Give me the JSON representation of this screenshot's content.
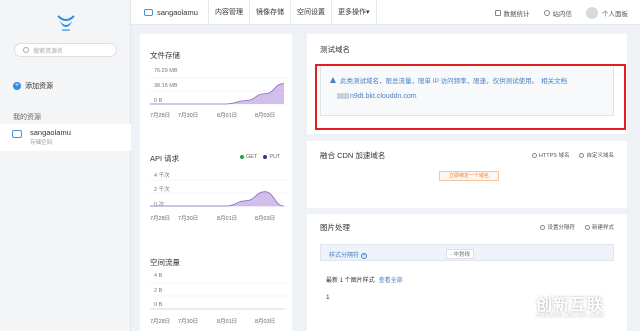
{
  "sidebar": {
    "search_placeholder": "搜索资源名",
    "add_resource_label": "添加资源",
    "my_resources_label": "我的资源",
    "resource": {
      "name": "sangaolamu",
      "type": "存储空间"
    }
  },
  "topbar": {
    "bucket_name": "sangaolamu",
    "tabs": [
      "内容管理",
      "镜像存储",
      "空间设置",
      "更多操作"
    ],
    "more_caret": "▾",
    "stats_label": "数据统计",
    "messages_label": "站内信",
    "user_label": "个人面板"
  },
  "storage_chart": {
    "title": "文件存储",
    "y_ticks": [
      "76.29 MB",
      "38.15 MB",
      "0 B"
    ],
    "x_ticks": [
      "7月28日",
      "7月30日",
      "8月01日",
      "8月03日"
    ]
  },
  "api_chart": {
    "title": "API 请求",
    "legend": [
      {
        "name": "GET",
        "color": "#2e9e44"
      },
      {
        "name": "PUT",
        "color": "#3a2c8a"
      }
    ],
    "y_ticks": [
      "4 千次",
      "2 千次",
      "0 次"
    ],
    "x_ticks": [
      "7月28日",
      "7月30日",
      "8月01日",
      "8月03日"
    ]
  },
  "traffic_chart": {
    "title": "空间流量",
    "y_ticks": [
      "4 B",
      "2 B",
      "0 B"
    ],
    "x_ticks": [
      "7月28日",
      "7月30日",
      "8月01日",
      "8月03日"
    ]
  },
  "chart_data": [
    {
      "type": "area",
      "title": "文件存储",
      "x": [
        "7月28日",
        "7月29日",
        "7月30日",
        "7月31日",
        "8月01日",
        "8月02日",
        "8月03日",
        "8月04日"
      ],
      "series": [
        {
          "values": [
            0,
            0,
            0,
            0,
            0,
            10,
            30,
            60
          ]
        }
      ],
      "ylim": [
        0,
        76.29
      ],
      "yunit": "MB"
    },
    {
      "type": "area",
      "title": "API 请求",
      "x": [
        "7月28日",
        "7月29日",
        "7月30日",
        "7月31日",
        "8月01日",
        "8月02日",
        "8月03日",
        "8月04日"
      ],
      "series": [
        {
          "name": "GET",
          "values": [
            0,
            0,
            0,
            0,
            0,
            0,
            0,
            0
          ]
        },
        {
          "name": "PUT",
          "values": [
            0,
            0,
            0,
            0,
            0,
            800,
            2200,
            0
          ]
        }
      ],
      "ylim": [
        0,
        4000
      ]
    },
    {
      "type": "area",
      "title": "空间流量",
      "x": [
        "7月28日",
        "7月30日",
        "8月01日",
        "8月03日"
      ],
      "series": [
        {
          "values": [
            0,
            0,
            0,
            0
          ]
        }
      ],
      "ylim": [
        0,
        4
      ]
    }
  ],
  "test_domain": {
    "title": "测试域名",
    "notice": "此类测试域名，限总流量，限单 IP 访问频率，限速，仅供测试使用。",
    "doc_link": "相关文档",
    "domain_suffix": "n9dt.bkt.clouddn.com"
  },
  "cdn": {
    "title": "融合 CDN 加速域名",
    "https_label": "HTTPS 域名",
    "custom_label": "自定义域名",
    "bind_button": "立即绑定一个域名"
  },
  "image": {
    "title": "图片处理",
    "separator_settings": "设置分隔符",
    "new_style": "新建样式",
    "style_sep_label": "样式分隔符",
    "style_sep_value": "- 中划线",
    "latest_label": "最新 1 个图片样式",
    "view_all": "查看全部",
    "row_number": "1"
  },
  "watermark": {
    "title": "创新互联",
    "subtitle": "CHUANG XIN HU LIAN"
  },
  "colors": {
    "accent": "#4a7fc1",
    "highlight_box": "#e0201f",
    "chart_fill": "#c9b3e6",
    "chart_stroke": "#8e6bc7"
  }
}
